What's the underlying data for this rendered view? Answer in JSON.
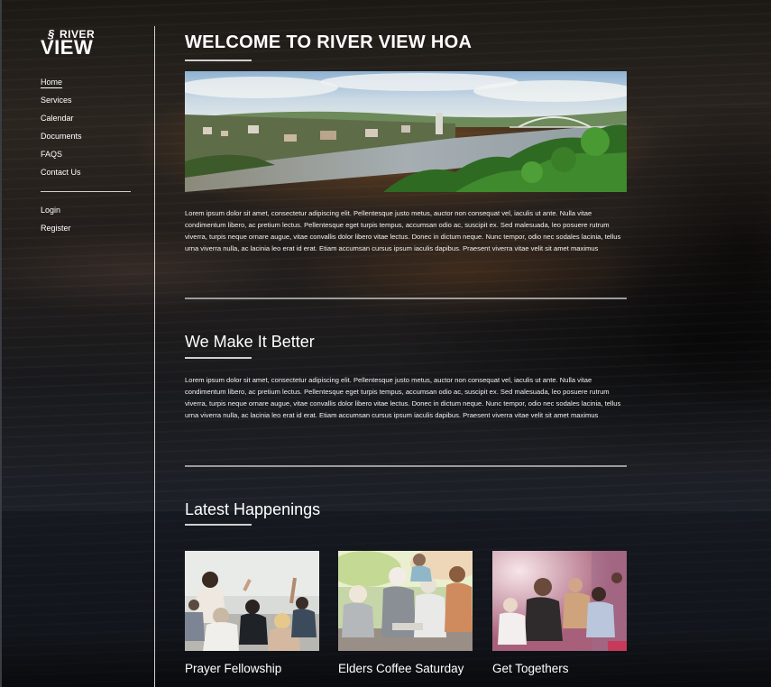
{
  "logo": {
    "mark": "§",
    "river": "RIVER",
    "view": "VIEW"
  },
  "nav": {
    "items": [
      {
        "label": "Home",
        "active": true
      },
      {
        "label": "Services"
      },
      {
        "label": "Calendar"
      },
      {
        "label": "Documents"
      },
      {
        "label": "FAQS"
      },
      {
        "label": "Contact Us"
      }
    ],
    "account": [
      {
        "label": "Login"
      },
      {
        "label": "Register"
      }
    ]
  },
  "main": {
    "title": "WELCOME TO RIVER VIEW HOA",
    "intro": "Lorem ipsum dolor sit amet, consectetur adipiscing elit. Pellentesque justo metus, auctor non consequat vel, iaculis ut ante. Nulla vitae condimentum libero, ac pretium lectus. Pellentesque eget turpis tempus, accumsan odio ac, suscipit ex. Sed malesuada, leo posuere rutrum viverra, turpis neque ornare augue, vitae convallis dolor libero vitae lectus. Donec in dictum neque. Nunc tempor, odio nec sodales lacinia, tellus urna viverra nulla, ac lacinia leo erat id erat. Etiam accumsan cursus ipsum iaculis dapibus. Praesent viverra vitae velit sit amet maximus",
    "section2": {
      "title": "We Make It Better",
      "body": "Lorem ipsum dolor sit amet, consectetur adipiscing elit. Pellentesque justo metus, auctor non consequat vel, iaculis ut ante. Nulla vitae condimentum libero, ac pretium lectus. Pellentesque eget turpis tempus, accumsan odio ac, suscipit ex. Sed malesuada, leo posuere rutrum viverra, turpis neque ornare augue, vitae convallis dolor libero vitae lectus. Donec in dictum neque. Nunc tempor, odio nec sodales lacinia, tellus urna viverra nulla, ac lacinia leo erat id erat. Etiam accumsan cursus ipsum iaculis dapibus. Praesent viverra vitae velit sit amet maximus"
    },
    "section3": {
      "title": "Latest Happenings",
      "cards": [
        {
          "title": "Prayer Fellowship"
        },
        {
          "title": "Elders Coffee Saturday"
        },
        {
          "title": "Get Togethers"
        }
      ]
    }
  },
  "colors": {
    "text": "#ffffff",
    "divider": "#cfcfcf",
    "rule": "#9b9b9b",
    "background": "#1e1b19"
  }
}
